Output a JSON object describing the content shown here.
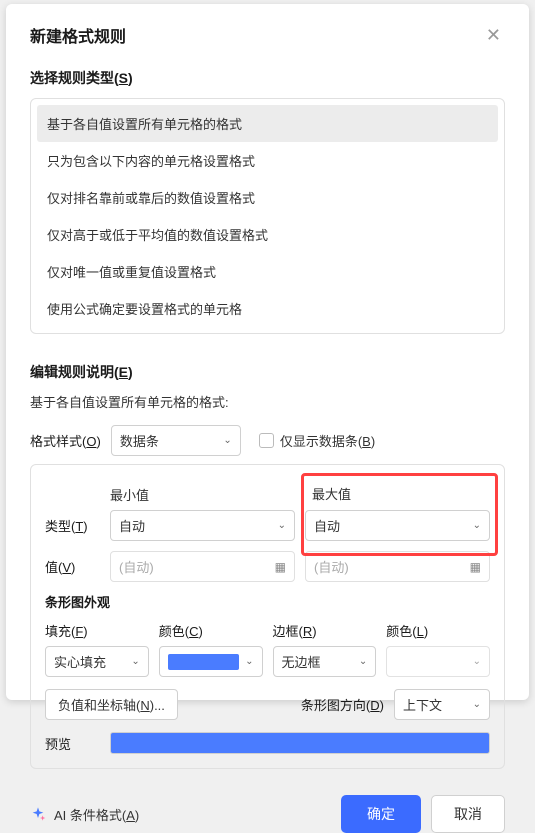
{
  "dialog": {
    "title": "新建格式规则"
  },
  "section1": {
    "title_pre": "选择规则类型(",
    "title_u": "S",
    "title_post": ")",
    "rules": [
      "基于各自值设置所有单元格的格式",
      "只为包含以下内容的单元格设置格式",
      "仅对排名靠前或靠后的数值设置格式",
      "仅对高于或低于平均值的数值设置格式",
      "仅对唯一值或重复值设置格式",
      "使用公式确定要设置格式的单元格"
    ]
  },
  "section2": {
    "title_pre": "编辑规则说明(",
    "title_u": "E",
    "title_post": ")",
    "desc": "基于各自值设置所有单元格的格式:",
    "format_style_label_pre": "格式样式(",
    "format_style_label_u": "O",
    "format_style_label_post": ")",
    "format_style_value": "数据条",
    "show_bar_only_pre": "仅显示数据条(",
    "show_bar_only_u": "B",
    "show_bar_only_post": ")"
  },
  "config": {
    "min_label": "最小值",
    "max_label": "最大值",
    "type_label_pre": "类型(",
    "type_label_u": "T",
    "type_label_post": ")",
    "type_min": "自动",
    "type_max": "自动",
    "value_label_pre": "值(",
    "value_label_u": "V",
    "value_label_post": ")",
    "value_min_placeholder": "(自动)",
    "value_max_placeholder": "(自动)"
  },
  "appearance": {
    "title": "条形图外观",
    "fill_label_pre": "填充(",
    "fill_label_u": "F",
    "fill_label_post": ")",
    "color1_label_pre": "颜色(",
    "color1_label_u": "C",
    "color1_label_post": ")",
    "border_label_pre": "边框(",
    "border_label_u": "R",
    "border_label_post": ")",
    "color2_label_pre": "颜色(",
    "color2_label_u": "L",
    "color2_label_post": ")",
    "fill_value": "实心填充",
    "border_value": "无边框",
    "neg_axis_pre": "负值和坐标轴(",
    "neg_axis_u": "N",
    "neg_axis_post": ")...",
    "bar_direction_label_pre": "条形图方向(",
    "bar_direction_label_u": "D",
    "bar_direction_label_post": ")",
    "bar_direction_value": "上下文",
    "preview_label": "预览",
    "bar_color": "#4a7cff"
  },
  "footer": {
    "ai_link_pre": "AI 条件格式(",
    "ai_link_u": "A",
    "ai_link_post": ")",
    "ok": "确定",
    "cancel": "取消"
  }
}
